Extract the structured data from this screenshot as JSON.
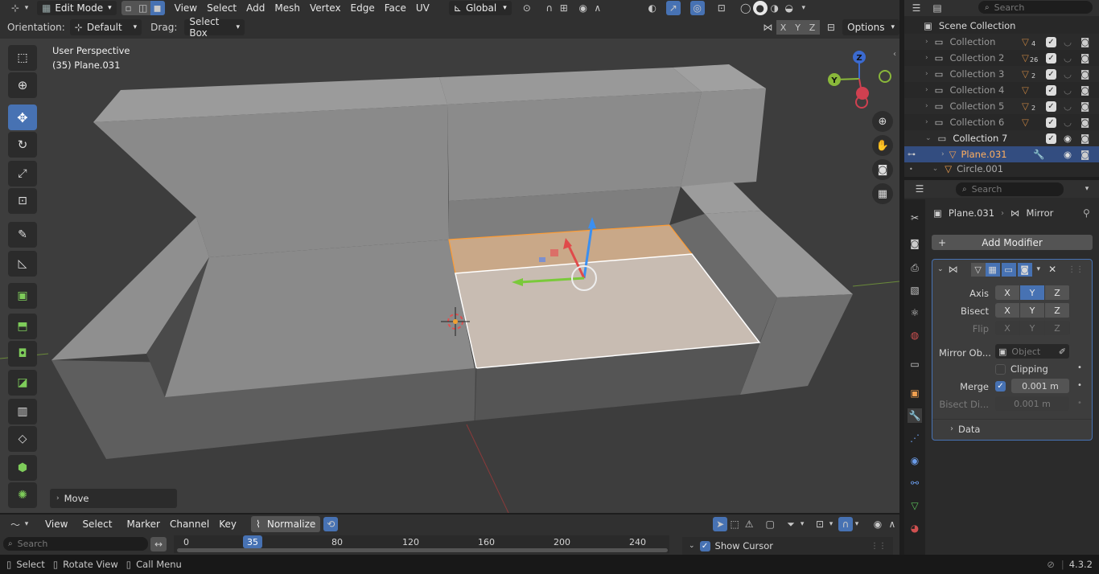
{
  "header": {
    "mode": "Edit Mode",
    "menus": [
      "View",
      "Select",
      "Add",
      "Mesh",
      "Vertex",
      "Edge",
      "Face",
      "UV"
    ],
    "transform_orientation": "Global"
  },
  "toolsettings": {
    "orientation_label": "Orientation:",
    "orientation_value": "Default",
    "drag_label": "Drag:",
    "drag_value": "Select Box",
    "axis_x": "X",
    "axis_y": "Y",
    "axis_z": "Z",
    "options": "Options"
  },
  "viewport": {
    "perspective": "User Perspective",
    "object_info": "(35) Plane.031",
    "gizmo_x": "X",
    "gizmo_y": "Y",
    "gizmo_z": "Z",
    "operator_panel": "Move"
  },
  "outliner": {
    "search_placeholder": "Search",
    "root": "Scene Collection",
    "rows": [
      {
        "name": "Collection",
        "count": "4"
      },
      {
        "name": "Collection 2",
        "count": "26"
      },
      {
        "name": "Collection 3",
        "count": "2"
      },
      {
        "name": "Collection 4",
        "count": ""
      },
      {
        "name": "Collection 5",
        "count": "2"
      },
      {
        "name": "Collection 6",
        "count": ""
      },
      {
        "name": "Collection 7",
        "count": ""
      },
      {
        "name": "Plane.031",
        "count": ""
      },
      {
        "name": "Circle.001",
        "count": ""
      }
    ]
  },
  "properties": {
    "search_placeholder": "Search",
    "object_name": "Plane.031",
    "modifier_name": "Mirror",
    "add_modifier": "Add Modifier",
    "axis_label": "Axis",
    "bisect_label": "Bisect",
    "flip_label": "Flip",
    "x": "X",
    "y": "Y",
    "z": "Z",
    "mirror_object_label": "Mirror Ob...",
    "mirror_object_placeholder": "Object",
    "clipping_label": "Clipping",
    "merge_label": "Merge",
    "merge_value": "0.001 m",
    "bisect_dist_label": "Bisect Di...",
    "bisect_dist_value": "0.001 m",
    "data_label": "Data"
  },
  "timeline": {
    "menus": [
      "View",
      "Select",
      "Marker",
      "Channel",
      "Key"
    ],
    "normalize": "Normalize",
    "search_placeholder": "Search",
    "current_frame": "35",
    "ticks": [
      "0",
      "80",
      "120",
      "160",
      "200",
      "240"
    ],
    "show_cursor": "Show Cursor"
  },
  "status": {
    "select": "Select",
    "rotate_view": "Rotate View",
    "call_menu": "Call Menu",
    "version": "4.3.2"
  },
  "colors": {
    "accent": "#4772b3",
    "selection_orange": "#ff9c33",
    "viewport_bg": "#3d3d3d"
  }
}
